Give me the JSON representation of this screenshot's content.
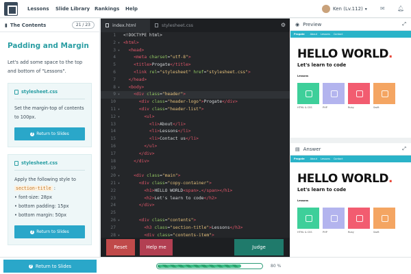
{
  "nav": {
    "items": [
      "Lessons",
      "Slide Library",
      "Rankings",
      "Help"
    ]
  },
  "user": {
    "name": "Ken (Lv.112)"
  },
  "icons": {
    "logo": "progate-logo-icon",
    "notification": "bell-icon",
    "mail": "envelope-icon",
    "book": "book-icon",
    "gear": "gear-icon",
    "eye": "eye-icon",
    "expand": "expand-icon",
    "file": "file-icon"
  },
  "left": {
    "header": "The Contents",
    "counter": "21 / 23",
    "title": "Padding and Margin",
    "intro": "Let's add some space to the top and bottom of \"Lessons\".",
    "card1": {
      "file": "stylesheet.css",
      "text": "Set the margin-top of contents to 100px.",
      "button": "Return to Slides"
    },
    "card2": {
      "file": "stylesheet.css",
      "text_before": "Apply the following style to",
      "tag": "section-title",
      "text_after": ":",
      "items": [
        "font-size: 28px",
        "bottom padding: 15px",
        "bottom margin: 50px"
      ],
      "button": "Return to Slides"
    }
  },
  "editor": {
    "tabs": [
      "index.html",
      "stylesheet.css"
    ],
    "buttons": {
      "reset": "Reset",
      "help": "Help me",
      "judge": "Judge"
    },
    "lines": [
      {
        "n": "1",
        "arrow": "",
        "parts": [
          {
            "c": "w",
            "t": "<!DOCTYPE html>"
          }
        ]
      },
      {
        "n": "2",
        "arrow": "▾",
        "parts": [
          {
            "c": "t",
            "t": "<html>"
          }
        ]
      },
      {
        "n": "3",
        "arrow": "▾",
        "parts": [
          {
            "c": "w",
            "t": "  "
          },
          {
            "c": "t",
            "t": "<head>"
          }
        ]
      },
      {
        "n": "4",
        "arrow": "",
        "parts": [
          {
            "c": "w",
            "t": "    "
          },
          {
            "c": "t",
            "t": "<meta "
          },
          {
            "c": "a",
            "t": "charset"
          },
          {
            "c": "w",
            "t": "="
          },
          {
            "c": "s",
            "t": "\"utf-8\""
          },
          {
            "c": "t",
            "t": ">"
          }
        ]
      },
      {
        "n": "5",
        "arrow": "",
        "parts": [
          {
            "c": "w",
            "t": "    "
          },
          {
            "c": "t",
            "t": "<title>"
          },
          {
            "c": "w",
            "t": "Progate"
          },
          {
            "c": "t",
            "t": "</title>"
          }
        ]
      },
      {
        "n": "6",
        "arrow": "",
        "parts": [
          {
            "c": "w",
            "t": "    "
          },
          {
            "c": "t",
            "t": "<link "
          },
          {
            "c": "a",
            "t": "rel"
          },
          {
            "c": "w",
            "t": "="
          },
          {
            "c": "s",
            "t": "\"stylesheet\""
          },
          {
            "c": "a",
            "t": " href"
          },
          {
            "c": "w",
            "t": "="
          },
          {
            "c": "s",
            "t": "\"stylesheet.css\""
          },
          {
            "c": "t",
            "t": ">"
          }
        ]
      },
      {
        "n": "7",
        "arrow": "",
        "parts": [
          {
            "c": "w",
            "t": "  "
          },
          {
            "c": "t",
            "t": "</head>"
          }
        ]
      },
      {
        "n": "8",
        "arrow": "▾",
        "parts": [
          {
            "c": "w",
            "t": "  "
          },
          {
            "c": "t",
            "t": "<body>"
          }
        ]
      },
      {
        "n": "9",
        "arrow": "▾",
        "hl": true,
        "parts": [
          {
            "c": "w",
            "t": "    "
          },
          {
            "c": "t",
            "t": "<div "
          },
          {
            "c": "a",
            "t": "class"
          },
          {
            "c": "w",
            "t": "="
          },
          {
            "c": "s",
            "t": "\"header\""
          },
          {
            "c": "t",
            "t": ">"
          }
        ]
      },
      {
        "n": "10",
        "arrow": "",
        "parts": [
          {
            "c": "w",
            "t": "      "
          },
          {
            "c": "t",
            "t": "<div "
          },
          {
            "c": "a",
            "t": "class"
          },
          {
            "c": "w",
            "t": "="
          },
          {
            "c": "s",
            "t": "\"header-logo\""
          },
          {
            "c": "t",
            "t": ">"
          },
          {
            "c": "w",
            "t": "Progate"
          },
          {
            "c": "t",
            "t": "</div>"
          }
        ]
      },
      {
        "n": "11",
        "arrow": "▾",
        "parts": [
          {
            "c": "w",
            "t": "      "
          },
          {
            "c": "t",
            "t": "<div "
          },
          {
            "c": "a",
            "t": "class"
          },
          {
            "c": "w",
            "t": "="
          },
          {
            "c": "s",
            "t": "\"header-list\""
          },
          {
            "c": "t",
            "t": ">"
          }
        ]
      },
      {
        "n": "12",
        "arrow": "▾",
        "parts": [
          {
            "c": "w",
            "t": "        "
          },
          {
            "c": "t",
            "t": "<ul>"
          }
        ]
      },
      {
        "n": "13",
        "arrow": "",
        "parts": [
          {
            "c": "w",
            "t": "          "
          },
          {
            "c": "t",
            "t": "<li>"
          },
          {
            "c": "w",
            "t": "About"
          },
          {
            "c": "t",
            "t": "</li>"
          }
        ]
      },
      {
        "n": "14",
        "arrow": "",
        "parts": [
          {
            "c": "w",
            "t": "          "
          },
          {
            "c": "t",
            "t": "<li>"
          },
          {
            "c": "w",
            "t": "Lessons"
          },
          {
            "c": "t",
            "t": "</li>"
          }
        ]
      },
      {
        "n": "15",
        "arrow": "",
        "parts": [
          {
            "c": "w",
            "t": "          "
          },
          {
            "c": "t",
            "t": "<li>"
          },
          {
            "c": "w",
            "t": "Contact us"
          },
          {
            "c": "t",
            "t": "</li>"
          }
        ]
      },
      {
        "n": "16",
        "arrow": "",
        "parts": [
          {
            "c": "w",
            "t": "        "
          },
          {
            "c": "t",
            "t": "</ul>"
          }
        ]
      },
      {
        "n": "17",
        "arrow": "",
        "parts": [
          {
            "c": "w",
            "t": "      "
          },
          {
            "c": "t",
            "t": "</div>"
          }
        ]
      },
      {
        "n": "18",
        "arrow": "",
        "parts": [
          {
            "c": "w",
            "t": "    "
          },
          {
            "c": "t",
            "t": "</div>"
          }
        ]
      },
      {
        "n": "19",
        "arrow": "",
        "parts": []
      },
      {
        "n": "20",
        "arrow": "▾",
        "parts": [
          {
            "c": "w",
            "t": "    "
          },
          {
            "c": "t",
            "t": "<div "
          },
          {
            "c": "a",
            "t": "class"
          },
          {
            "c": "w",
            "t": "="
          },
          {
            "c": "s",
            "t": "\"main\""
          },
          {
            "c": "t",
            "t": ">"
          }
        ]
      },
      {
        "n": "21",
        "arrow": "▾",
        "parts": [
          {
            "c": "w",
            "t": "      "
          },
          {
            "c": "t",
            "t": "<div "
          },
          {
            "c": "a",
            "t": "class"
          },
          {
            "c": "w",
            "t": "="
          },
          {
            "c": "s",
            "t": "\"copy-container\""
          },
          {
            "c": "t",
            "t": ">"
          }
        ]
      },
      {
        "n": "22",
        "arrow": "",
        "parts": [
          {
            "c": "w",
            "t": "        "
          },
          {
            "c": "t",
            "t": "<h1>"
          },
          {
            "c": "w",
            "t": "HELLO WORLD"
          },
          {
            "c": "t",
            "t": "<span>"
          },
          {
            "c": "w",
            "t": "."
          },
          {
            "c": "t",
            "t": "</span></h1>"
          }
        ]
      },
      {
        "n": "23",
        "arrow": "",
        "parts": [
          {
            "c": "w",
            "t": "        "
          },
          {
            "c": "t",
            "t": "<h2>"
          },
          {
            "c": "w",
            "t": "Let's learn to code"
          },
          {
            "c": "t",
            "t": "</h2>"
          }
        ]
      },
      {
        "n": "24",
        "arrow": "",
        "parts": [
          {
            "c": "w",
            "t": "      "
          },
          {
            "c": "t",
            "t": "</div>"
          }
        ]
      },
      {
        "n": "25",
        "arrow": "",
        "parts": []
      },
      {
        "n": "26",
        "arrow": "▾",
        "parts": [
          {
            "c": "w",
            "t": "      "
          },
          {
            "c": "t",
            "t": "<div "
          },
          {
            "c": "a",
            "t": "class"
          },
          {
            "c": "w",
            "t": "="
          },
          {
            "c": "s",
            "t": "\"contents\""
          },
          {
            "c": "t",
            "t": ">"
          }
        ]
      },
      {
        "n": "27",
        "arrow": "",
        "parts": [
          {
            "c": "w",
            "t": "        "
          },
          {
            "c": "t",
            "t": "<h3 "
          },
          {
            "c": "a",
            "t": "class"
          },
          {
            "c": "w",
            "t": "="
          },
          {
            "c": "s",
            "t": "\"section-title\""
          },
          {
            "c": "t",
            "t": ">"
          },
          {
            "c": "w",
            "t": "Lessons"
          },
          {
            "c": "t",
            "t": "</h3>"
          }
        ]
      },
      {
        "n": "28",
        "arrow": "▾",
        "parts": [
          {
            "c": "w",
            "t": "        "
          },
          {
            "c": "t",
            "t": "<div "
          },
          {
            "c": "a",
            "t": "class"
          },
          {
            "c": "w",
            "t": "="
          },
          {
            "c": "s",
            "t": "\"contents-item\""
          },
          {
            "c": "t",
            "t": ">"
          }
        ]
      },
      {
        "n": "29",
        "arrow": "",
        "parts": [
          {
            "c": "w",
            "t": "          "
          },
          {
            "c": "t",
            "t": "<img "
          },
          {
            "c": "a",
            "t": "src"
          },
          {
            "c": "w",
            "t": "="
          },
          {
            "c": "s",
            "t": "\"https://s3-ap-northeast-1.amazonaws.com/proga"
          }
        ]
      }
    ]
  },
  "right": {
    "preview_label": "Preview",
    "answer_label": "Answer",
    "site": {
      "logo": "Progate",
      "nav": [
        "About",
        "Lessons",
        "Contact"
      ],
      "hello": "HELLO WORLD",
      "dot": ".",
      "sub": "Let's learn to code",
      "section": "Lessons",
      "tiles": [
        {
          "name": "HTML & CSS",
          "color": "#3ecf9a"
        },
        {
          "name": "PHP",
          "color": "#b3b4ee"
        },
        {
          "name": "Ruby",
          "color": "#f25c70"
        },
        {
          "name": "Swift",
          "color": "#f4a562"
        }
      ]
    }
  },
  "bottom": {
    "return_button": "Return to Slides",
    "progress_percent": 80,
    "progress_label": "80 %"
  },
  "colors": {
    "accent": "#2aa7c9",
    "teal": "#2a9ea3",
    "reset": "#c04a4a",
    "help": "#b23f52",
    "judge": "#1f7a6b",
    "progress": "#2aa46f"
  }
}
